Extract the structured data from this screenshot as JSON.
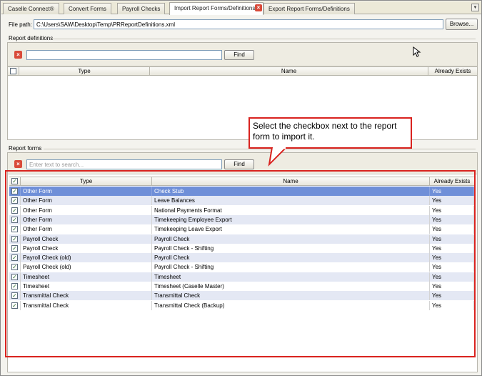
{
  "tabs": [
    {
      "label": "Caselle Connect®",
      "active": false
    },
    {
      "label": "Convert Forms",
      "active": false
    },
    {
      "label": "Payroll Checks",
      "active": false
    },
    {
      "label": "Import Report Forms/Definitions",
      "active": true
    },
    {
      "label": "Export Report Forms/Definitions",
      "active": false
    }
  ],
  "icons": {
    "tab_close": "close-icon",
    "tab_dropdown": "chevron-down-icon",
    "clear_search": "clear-search-icon",
    "checkbox_checked": "checkmark-icon",
    "cursor": "mouse-pointer-icon"
  },
  "file_path": {
    "label": "File path:",
    "value": "C:\\Users\\SAW\\Desktop\\Temp\\PRReportDefinitions.xml",
    "browse_label": "Browse..."
  },
  "report_definitions": {
    "title": "Report definitions",
    "search_value": "",
    "find_label": "Find",
    "columns": [
      "Type",
      "Name",
      "Already Exists"
    ],
    "rows": []
  },
  "report_forms": {
    "title": "Report forms",
    "search_placeholder": "Enter text to search...",
    "find_label": "Find",
    "columns": [
      "Type",
      "Name",
      "Already Exists"
    ],
    "rows": [
      {
        "checked": true,
        "type": "Other Form",
        "name": "Check Stub",
        "exists": "Yes",
        "selected": true
      },
      {
        "checked": true,
        "type": "Other Form",
        "name": "Leave Balances",
        "exists": "Yes"
      },
      {
        "checked": true,
        "type": "Other Form",
        "name": "National Payments Format",
        "exists": "Yes"
      },
      {
        "checked": true,
        "type": "Other Form",
        "name": "Timekeeping Employee Export",
        "exists": "Yes"
      },
      {
        "checked": true,
        "type": "Other Form",
        "name": "Timekeeping Leave Export",
        "exists": "Yes"
      },
      {
        "checked": true,
        "type": "Payroll Check",
        "name": "Payroll Check",
        "exists": "Yes"
      },
      {
        "checked": true,
        "type": "Payroll Check",
        "name": "Payroll Check - Shifting",
        "exists": "Yes"
      },
      {
        "checked": true,
        "type": "Payroll Check (old)",
        "name": "Payroll Check",
        "exists": "Yes"
      },
      {
        "checked": true,
        "type": "Payroll Check (old)",
        "name": "Payroll Check - Shifting",
        "exists": "Yes"
      },
      {
        "checked": true,
        "type": "Timesheet",
        "name": "Timesheet",
        "exists": "Yes"
      },
      {
        "checked": true,
        "type": "Timesheet",
        "name": "Timesheet (Caselle Master)",
        "exists": "Yes"
      },
      {
        "checked": true,
        "type": "Transmittal Check",
        "name": "Transmittal Check",
        "exists": "Yes"
      },
      {
        "checked": true,
        "type": "Transmittal Check",
        "name": "Transmittal Check (Backup)",
        "exists": "Yes"
      }
    ]
  },
  "callout": {
    "text": "Select the checkbox next to the report form to import it."
  },
  "colors": {
    "accent_red": "#d9231f",
    "selected_row": "#6f8fd8",
    "alt_row": "#e4e8f4"
  }
}
